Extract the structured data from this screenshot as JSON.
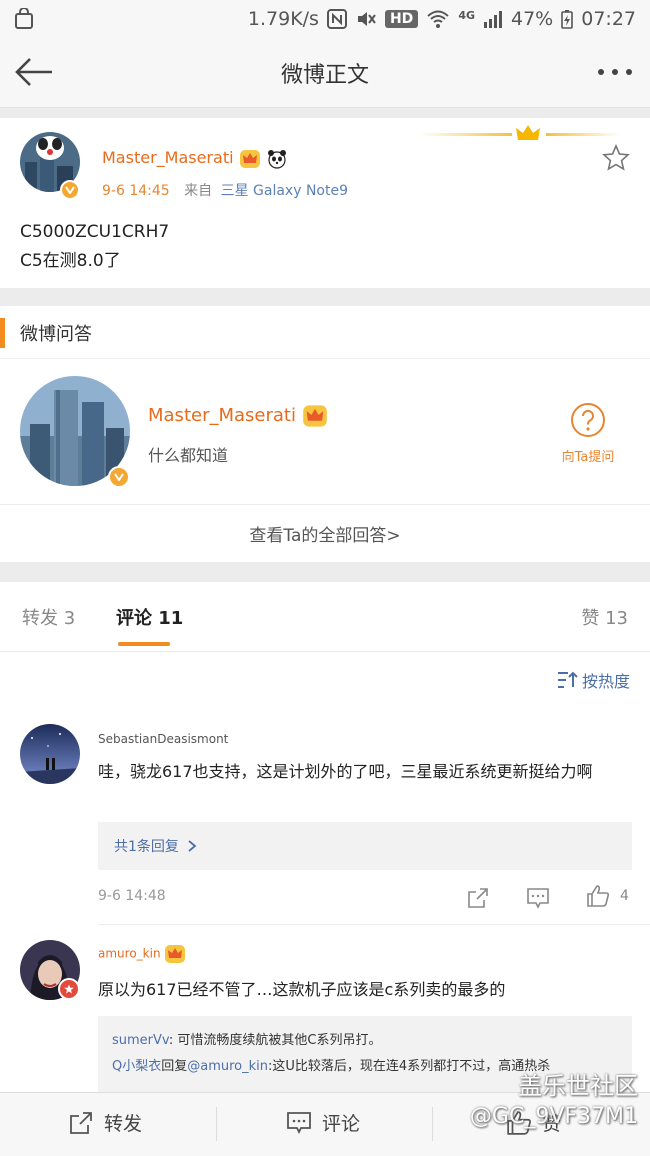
{
  "status_bar": {
    "speed": "1.79K/s",
    "hd": "HD",
    "network": "4G",
    "battery": "47%",
    "time": "07:27"
  },
  "nav": {
    "title": "微博正文"
  },
  "post": {
    "username": "Master_Maserati",
    "time": "9-6 14:45",
    "source_label": "来自",
    "source": "三星 Galaxy Note9",
    "lines": [
      "C5000ZCU1CRH7",
      "C5在测8.0了"
    ]
  },
  "qa": {
    "title": "微博问答",
    "name": "Master_Maserati",
    "desc": "什么都知道",
    "ask_label": "向Ta提问",
    "view_all": "查看Ta的全部回答>"
  },
  "tabs": {
    "repost": "转发 3",
    "comment": "评论 11",
    "like": "赞 13"
  },
  "sort_label": "按热度",
  "comments": [
    {
      "name": "SebastianDeasismont",
      "text": "哇，骁龙617也支持，这是计划外的了吧，三星最近系统更新挺给力啊",
      "reply_link": "共1条回复",
      "time": "9-6 14:48",
      "likes": "4"
    },
    {
      "name": "amuro_kin",
      "text": "原以为617已经不管了…这款机子应该是c系列卖的最多的",
      "replies": [
        {
          "user": "sumerVv",
          "sep": ": ",
          "text": "可惜流畅度续航被其他C系列吊打。"
        },
        {
          "user": "Q小梨衣",
          "mid": "回复",
          "mention": "@amuro_kin",
          "sep": ":",
          "text": "这U比较落后，现在连4系列都打不过，高通热杀"
        }
      ]
    }
  ],
  "bottom": {
    "repost": "转发",
    "comment": "评论",
    "like": "赞"
  },
  "watermark": {
    "line1": "盖乐世社区",
    "line2": "@GC_9VF37M1"
  },
  "colors": {
    "accent": "#f28b20",
    "username": "#e86b1c",
    "link": "#4d6fa8",
    "verify": "#f3a833"
  }
}
